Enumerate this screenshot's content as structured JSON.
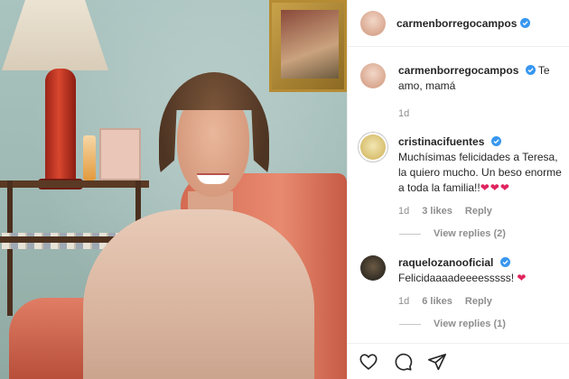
{
  "post": {
    "author": "carmenborregocampos",
    "author_verified": true
  },
  "caption": {
    "user": "carmenborregocampos",
    "text": "Te amo, mamá",
    "time": "1d"
  },
  "comments": [
    {
      "user": "cristinacifuentes",
      "text": "Muchísimas felicidades a Teresa, la quiero mucho. Un beso enorme a toda la familia!!",
      "emoji": "❤❤❤",
      "time": "1d",
      "likes": "3 likes",
      "reply": "Reply",
      "view_replies": "View replies (2)"
    },
    {
      "user": "raquelozanooficial",
      "text": "Felicidaaaadeeeesssss!",
      "emoji": "❤",
      "time": "1d",
      "likes": "6 likes",
      "reply": "Reply",
      "view_replies": "View replies (1)"
    }
  ],
  "actions": {
    "like_icon": "heart-outline-icon",
    "comment_icon": "comment-bubble-icon",
    "share_icon": "paper-plane-icon"
  },
  "colors": {
    "verified_blue": "#3897f0",
    "heart_red": "#e0245e",
    "muted_text": "#8e8e8e"
  }
}
